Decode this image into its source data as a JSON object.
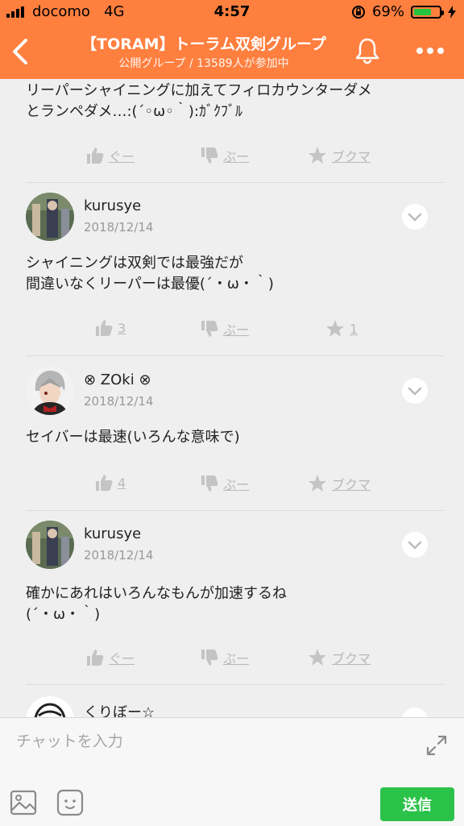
{
  "status_bar": {
    "carrier": "docomo",
    "network": "4G",
    "time": "4:57",
    "battery": "69%",
    "battery_level": 0.69
  },
  "header": {
    "title": "【TORAM】トーラム双剣グループ",
    "subtitle": "公開グループ / 13589人が参加中",
    "back_icon": "chevron-left-icon",
    "bell_icon": "bell-icon",
    "more_icon": "more-dots-icon"
  },
  "messages": [
    {
      "body": "リーパーシャイニングに加えてフィロカウンターダメ\nとランペダメ…:(´◦ω◦｀):ｶﾞｸﾌﾞﾙ",
      "like": "ぐー",
      "dislike": "ぶー",
      "bookmark": "ブクマ"
    },
    {
      "user": "kurusye",
      "date": "2018/12/14",
      "body": "シャイニングは双剣では最強だが\n間違いなくリーパーは最優(´・ω・｀)",
      "like": "3",
      "dislike": "ぶー",
      "bookmark": "1"
    },
    {
      "user": "⊗ ZOki ⊗",
      "date": "2018/12/14",
      "body": "セイバーは最速(いろんな意味で)",
      "like": "4",
      "dislike": "ぶー",
      "bookmark": "ブクマ"
    },
    {
      "user": "kurusye",
      "date": "2018/12/14",
      "body": "確かにあれはいろんなもんが加速するね\n(´・ω・｀)",
      "like": "ぐー",
      "dislike": "ぶー",
      "bookmark": "ブクマ"
    },
    {
      "user": "くりぼー☆"
    }
  ],
  "input": {
    "placeholder": "チャットを入力",
    "send_label": "送信"
  },
  "colors": {
    "header": "#ff7f3f",
    "send": "#2bc24a",
    "action": "#b8b8b8"
  }
}
